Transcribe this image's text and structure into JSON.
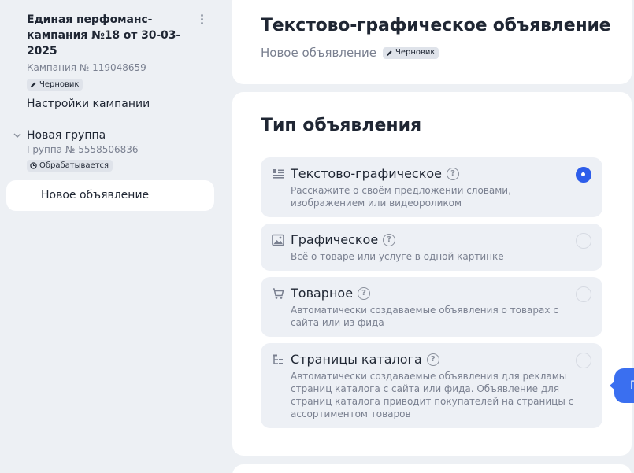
{
  "sidebar": {
    "campaign": {
      "title": "Единая перфоманс-кампания №18 от 30-03-2025",
      "subtitle": "Кампания № 119048659",
      "badge": "Черновик"
    },
    "settings_link": "Настройки кампании",
    "group": {
      "title": "Новая группа",
      "subtitle": "Группа № 5558506836",
      "badge": "Обрабатывается"
    },
    "active_item": "Новое объявление"
  },
  "header": {
    "title": "Текстово-графическое объявление",
    "subtitle": "Новое объявление",
    "badge": "Черновик"
  },
  "ad_type": {
    "title": "Тип объявления",
    "options": [
      {
        "title": "Текстово-графическое",
        "description": "Расскажите о своём предложении словами, изображением или видеороликом",
        "icon": "text-graphic-icon",
        "selected": true
      },
      {
        "title": "Графическое",
        "description": "Всё о товаре или услуге в одной картинке",
        "icon": "image-icon",
        "selected": false
      },
      {
        "title": "Товарное",
        "description": "Автоматически создаваемые объявления о товарах с сайта или из фида",
        "icon": "cart-icon",
        "selected": false
      },
      {
        "title": "Страницы каталога",
        "description": "Автоматически создаваемые объявления для рекламы страниц каталога с сайта или фида. Объявление для страниц каталога приводит покупателей на страницы с ассортиментом товаров",
        "icon": "catalog-tree-icon",
        "selected": false
      }
    ]
  },
  "floating_button": {
    "label": "П"
  },
  "colors": {
    "background": "#edf0f4",
    "card": "#ffffff",
    "option_bg": "#edf0f5",
    "accent": "#2d5dea",
    "muted_text": "#7a8090",
    "text": "#1f2633"
  }
}
